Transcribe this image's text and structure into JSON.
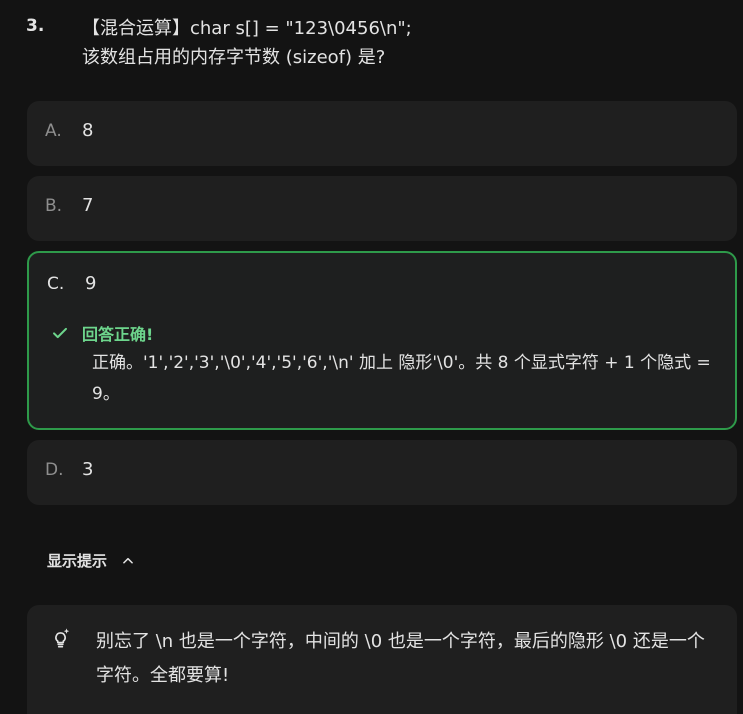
{
  "question": {
    "number": "3.",
    "line1": "【混合运算】char s[] = \"123\\0456\\n\";",
    "line2": "该数组占用的内存字节数 (sizeof) 是?"
  },
  "options": [
    {
      "letter": "A.",
      "text": "8"
    },
    {
      "letter": "B.",
      "text": "7"
    },
    {
      "letter": "C.",
      "text": "9"
    },
    {
      "letter": "D.",
      "text": "3"
    }
  ],
  "feedback": {
    "title": "回答正确!",
    "body": "正确。'1','2','3','\\0','4','5','6','\\n' 加上 隐形'\\0'。共 8 个显式字符 + 1 个隐式 = 9。",
    "accent": "#2e9a4a"
  },
  "hint": {
    "toggle_label": "显示提示",
    "text": "别忘了 \\n 也是一个字符，中间的 \\0 也是一个字符，最后的隐形 \\0 还是一个字符。全都要算!"
  },
  "icons": {
    "correct": "check-icon",
    "toggle": "chevron-up-icon",
    "hint": "lightbulb-sparkle-icon"
  }
}
